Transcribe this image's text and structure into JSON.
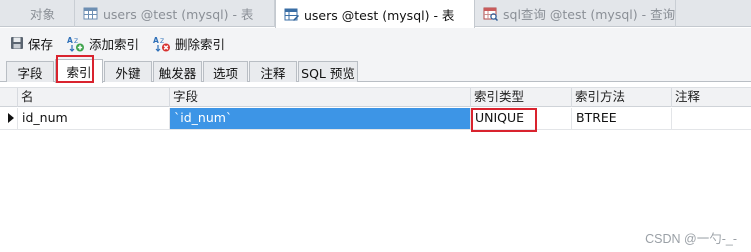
{
  "doc_tabs": [
    {
      "label": "对象",
      "icon": "none",
      "active": false
    },
    {
      "label": "users @test (mysql) - 表",
      "icon": "table-grid-icon",
      "active": false
    },
    {
      "label": "users @test (mysql) - 表",
      "icon": "table-design-icon",
      "active": true
    },
    {
      "label": "sql查询 @test (mysql) - 查询",
      "icon": "query-icon",
      "active": false
    }
  ],
  "toolbar": {
    "save_label": "保存",
    "add_index_label": "添加索引",
    "delete_index_label": "删除索引"
  },
  "subtabs": [
    {
      "label": "字段",
      "active": false
    },
    {
      "label": "索引",
      "active": true
    },
    {
      "label": "外键",
      "active": false
    },
    {
      "label": "触发器",
      "active": false
    },
    {
      "label": "选项",
      "active": false
    },
    {
      "label": "注释",
      "active": false
    },
    {
      "label": "SQL 预览",
      "active": false
    }
  ],
  "grid": {
    "columns": [
      "名",
      "字段",
      "索引类型",
      "索引方法",
      "注释"
    ],
    "rows": [
      [
        "id_num",
        "`id_num`",
        "UNIQUE",
        "BTREE",
        ""
      ]
    ]
  },
  "colors": {
    "selection": "#3d95e6",
    "highlight_box": "#d9232e"
  },
  "watermark": "CSDN @一勺-_-"
}
